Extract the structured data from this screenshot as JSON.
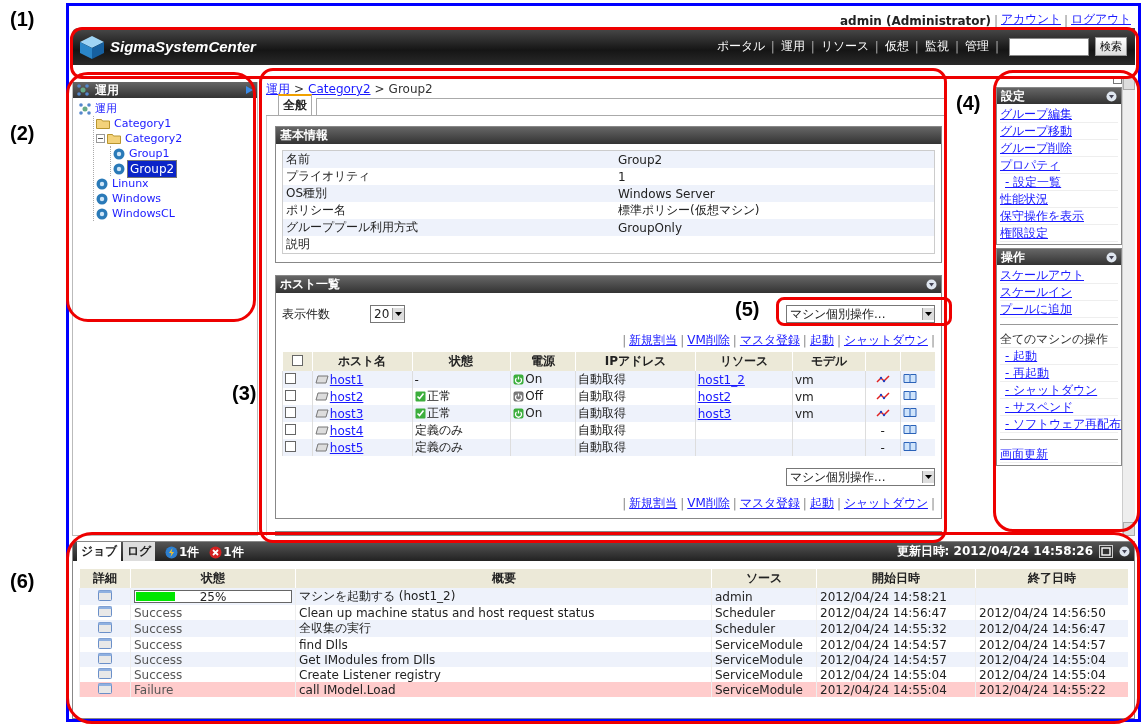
{
  "annotations": [
    {
      "label": "(1)"
    },
    {
      "label": "(2)"
    },
    {
      "label": "(3)"
    },
    {
      "label": "(4)"
    },
    {
      "label": "(5)"
    },
    {
      "label": "(6)"
    }
  ],
  "user_bar": {
    "user": "admin (Administrator)",
    "separator": "|",
    "links": [
      "アカウント",
      "ログアウト"
    ]
  },
  "header": {
    "logo": "SigmaSystemCenter",
    "separator": "|",
    "nav": [
      "ポータル",
      "運用",
      "リソース",
      "仮想",
      "監視",
      "管理"
    ],
    "search_button": "検索"
  },
  "tree": {
    "title": "運用",
    "items": [
      {
        "label": "運用",
        "kind": "root",
        "selected": false,
        "children": [
          {
            "label": "Category1",
            "kind": "folder",
            "selected": false
          },
          {
            "label": "Category2",
            "kind": "folder",
            "selected": false,
            "expanded": true,
            "children": [
              {
                "label": "Group1",
                "kind": "group",
                "selected": false
              },
              {
                "label": "Group2",
                "kind": "group",
                "selected": true
              }
            ]
          },
          {
            "label": "Linunx",
            "kind": "group",
            "selected": false
          },
          {
            "label": "Windows",
            "kind": "group",
            "selected": false
          },
          {
            "label": "WindowsCL",
            "kind": "group",
            "selected": false
          }
        ]
      }
    ]
  },
  "breadcrumb": {
    "separator": ">",
    "items": [
      "運用",
      "Category2",
      "Group2"
    ]
  },
  "tabs": [
    {
      "label": "全般",
      "selected": true
    }
  ],
  "basic_info": {
    "title": "基本情報",
    "rows": [
      {
        "label": "名前",
        "value": "Group2"
      },
      {
        "label": "プライオリティ",
        "value": "1"
      },
      {
        "label": "OS種別",
        "value": "Windows Server"
      },
      {
        "label": "ポリシー名",
        "value": "標準ポリシー(仮想マシン)"
      },
      {
        "label": "グループプール利用方式",
        "value": "GroupOnly"
      },
      {
        "label": "説明",
        "value": ""
      }
    ]
  },
  "hosts": {
    "title": "ホスト一覧",
    "all_checked": false,
    "page_size_label": "表示件数",
    "page_size": "20",
    "action_select": "マシン個別操作...",
    "separator": "|",
    "links": [
      "新規割当",
      "VM削除",
      "マスタ登録",
      "起動",
      "シャットダウン"
    ],
    "columns": [
      "ホスト名",
      "状態",
      "電源",
      "IPアドレス",
      "リソース",
      "モデル"
    ],
    "rows": [
      {
        "checked": false,
        "name": "host1",
        "status": "-",
        "status_ok": false,
        "power": "On",
        "power_on": true,
        "ip": "自動取得",
        "resource": "host1_2",
        "model": "vm",
        "graph": true
      },
      {
        "checked": false,
        "name": "host2",
        "status": "正常",
        "status_ok": true,
        "power": "Off",
        "power_on": false,
        "ip": "自動取得",
        "resource": "host2",
        "model": "vm",
        "graph": true
      },
      {
        "checked": false,
        "name": "host3",
        "status": "正常",
        "status_ok": true,
        "power": "On",
        "power_on": true,
        "ip": "自動取得",
        "resource": "host3",
        "model": "vm",
        "graph": true
      },
      {
        "checked": false,
        "name": "host4",
        "status": "定義のみ",
        "status_ok": false,
        "ip": "自動取得",
        "graph": false,
        "perf_text": "-"
      },
      {
        "checked": false,
        "name": "host5",
        "status": "定義のみ",
        "status_ok": false,
        "ip": "自動取得",
        "graph": false,
        "perf_text": "-"
      }
    ],
    "action_select_bottom": "マシン個別操作...",
    "links_bottom": [
      "新規割当",
      "VM削除",
      "マスタ登録",
      "起動",
      "シャットダウン"
    ]
  },
  "side_menu": [
    {
      "title": "設定",
      "items": [
        {
          "kind": "link",
          "label": "グループ編集"
        },
        {
          "kind": "link",
          "label": "グループ移動"
        },
        {
          "kind": "link",
          "label": "グループ削除"
        },
        {
          "kind": "link",
          "label": "プロパティ"
        },
        {
          "kind": "sublink",
          "label": "- 設定一覧"
        },
        {
          "kind": "link",
          "label": "性能状況"
        },
        {
          "kind": "link",
          "label": "保守操作を表示"
        },
        {
          "kind": "link",
          "label": "権限設定"
        }
      ]
    },
    {
      "title": "操作",
      "items": [
        {
          "kind": "link",
          "label": "スケールアウト"
        },
        {
          "kind": "link",
          "label": "スケールイン"
        },
        {
          "kind": "link",
          "label": "プールに追加"
        },
        {
          "kind": "divider"
        },
        {
          "kind": "heading",
          "label": "全てのマシンの操作"
        },
        {
          "kind": "sublink",
          "label": "- 起動"
        },
        {
          "kind": "sublink",
          "label": "- 再起動"
        },
        {
          "kind": "sublink",
          "label": "- シャットダウン"
        },
        {
          "kind": "sublink",
          "label": "- サスペンド"
        },
        {
          "kind": "sublink",
          "label": "- ソフトウェア再配布"
        },
        {
          "kind": "divider"
        },
        {
          "kind": "link",
          "label": "画面更新"
        }
      ]
    }
  ],
  "jobs": {
    "tabs": [
      {
        "label": "ジョブ",
        "selected": true
      },
      {
        "label": "ログ",
        "selected": false
      }
    ],
    "counts": [
      {
        "kind": "running",
        "text": "1件"
      },
      {
        "kind": "error",
        "text": "1件"
      }
    ],
    "updated": "更新日時: 2012/04/24 14:58:26",
    "columns": [
      "詳細",
      "状態",
      "概要",
      "ソース",
      "開始日時",
      "終了日時"
    ],
    "rows": [
      {
        "kind": "progress",
        "level": 0.25,
        "status": "25%",
        "summary": "マシンを起動する (host1_2)",
        "source": "admin",
        "start": "2012/04/24 14:58:21",
        "end": ""
      },
      {
        "kind": "success",
        "status": "Success",
        "summary": "Clean up machine status and host request status",
        "source": "Scheduler",
        "start": "2012/04/24 14:56:47",
        "end": "2012/04/24 14:56:50"
      },
      {
        "kind": "success",
        "status": "Success",
        "summary": "全収集の実行",
        "source": "Scheduler",
        "start": "2012/04/24 14:55:32",
        "end": "2012/04/24 14:56:47"
      },
      {
        "kind": "success",
        "status": "Success",
        "summary": "find Dlls",
        "source": "ServiceModule",
        "start": "2012/04/24 14:54:57",
        "end": "2012/04/24 14:54:57"
      },
      {
        "kind": "success",
        "status": "Success",
        "summary": "Get IModules from Dlls",
        "source": "ServiceModule",
        "start": "2012/04/24 14:54:57",
        "end": "2012/04/24 14:55:04"
      },
      {
        "kind": "success",
        "status": "Success",
        "summary": "Create Listener registry",
        "source": "ServiceModule",
        "start": "2012/04/24 14:55:04",
        "end": "2012/04/24 14:55:04"
      },
      {
        "kind": "failure",
        "status": "Failure",
        "summary": "call IModel.Load",
        "source": "ServiceModule",
        "start": "2012/04/24 14:55:04",
        "end": "2012/04/24 14:55:22"
      }
    ]
  }
}
